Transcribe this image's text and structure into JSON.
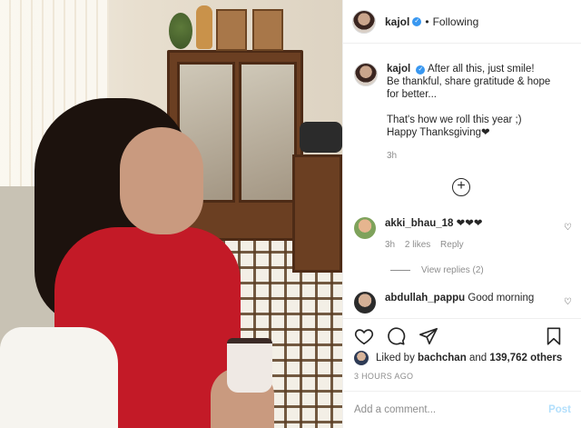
{
  "header": {
    "username": "kajol",
    "separator": "•",
    "follow_status": "Following"
  },
  "caption": {
    "username": "kajol",
    "lines": [
      "After all this, just smile!",
      "Be thankful, share gratitude & hope",
      "for better...",
      "That's how we roll this year ;)",
      "Happy Thanksgiving❤"
    ],
    "time": "3h"
  },
  "more_icon": "plus-circle-icon",
  "comments": [
    {
      "username": "akki_bhau_18",
      "text": "❤❤❤",
      "time": "3h",
      "likes": "2 likes",
      "reply": "Reply"
    },
    {
      "username": "abdullah_pappu",
      "text": "Good morning"
    }
  ],
  "view_replies": "View replies (2)",
  "likes": {
    "prefix": "Liked by",
    "user": "bachchan",
    "middle": "and",
    "others": "139,762 others"
  },
  "timestamp": "3 HOURS AGO",
  "add_comment": {
    "placeholder": "Add a comment...",
    "post_label": "Post"
  }
}
